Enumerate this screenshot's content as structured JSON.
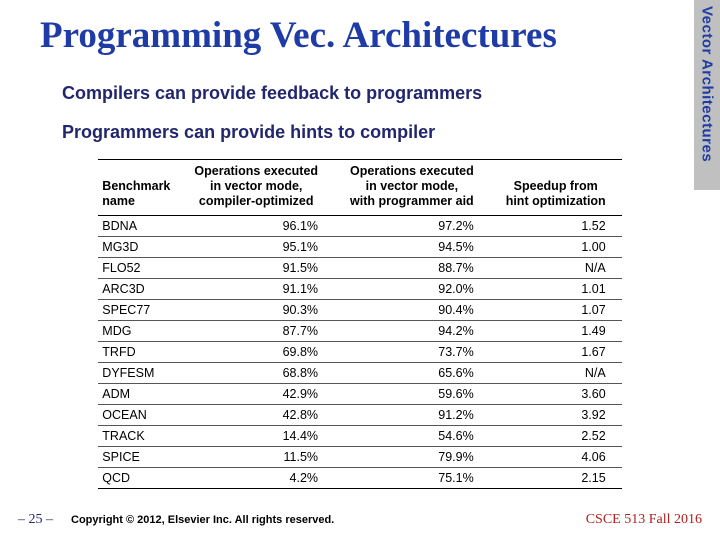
{
  "side_tab": "Vector Architectures",
  "title": "Programming Vec. Architectures",
  "line1": "Compilers can provide feedback to programmers",
  "line2": "Programmers can provide hints to compiler",
  "chart_data": {
    "type": "table",
    "headers": {
      "c0": "Benchmark\nname",
      "c1": "Operations executed\nin vector mode,\ncompiler-optimized",
      "c2": "Operations executed\nin vector mode,\nwith programmer aid",
      "c3": "Speedup from\nhint optimization"
    },
    "rows": [
      {
        "name": "BDNA",
        "opt": "96.1%",
        "aid": "97.2%",
        "speedup": "1.52"
      },
      {
        "name": "MG3D",
        "opt": "95.1%",
        "aid": "94.5%",
        "speedup": "1.00"
      },
      {
        "name": "FLO52",
        "opt": "91.5%",
        "aid": "88.7%",
        "speedup": "N/A"
      },
      {
        "name": "ARC3D",
        "opt": "91.1%",
        "aid": "92.0%",
        "speedup": "1.01"
      },
      {
        "name": "SPEC77",
        "opt": "90.3%",
        "aid": "90.4%",
        "speedup": "1.07"
      },
      {
        "name": "MDG",
        "opt": "87.7%",
        "aid": "94.2%",
        "speedup": "1.49"
      },
      {
        "name": "TRFD",
        "opt": "69.8%",
        "aid": "73.7%",
        "speedup": "1.67"
      },
      {
        "name": "DYFESM",
        "opt": "68.8%",
        "aid": "65.6%",
        "speedup": "N/A"
      },
      {
        "name": "ADM",
        "opt": "42.9%",
        "aid": "59.6%",
        "speedup": "3.60"
      },
      {
        "name": "OCEAN",
        "opt": "42.8%",
        "aid": "91.2%",
        "speedup": "3.92"
      },
      {
        "name": "TRACK",
        "opt": "14.4%",
        "aid": "54.6%",
        "speedup": "2.52"
      },
      {
        "name": "SPICE",
        "opt": "11.5%",
        "aid": "79.9%",
        "speedup": "4.06"
      },
      {
        "name": "QCD",
        "opt": "4.2%",
        "aid": "75.1%",
        "speedup": "2.15"
      }
    ]
  },
  "footer": {
    "page": "– 25 –",
    "copyright": "Copyright © 2012, Elsevier Inc. All rights reserved.",
    "course": "CSCE 513 Fall 2016"
  }
}
